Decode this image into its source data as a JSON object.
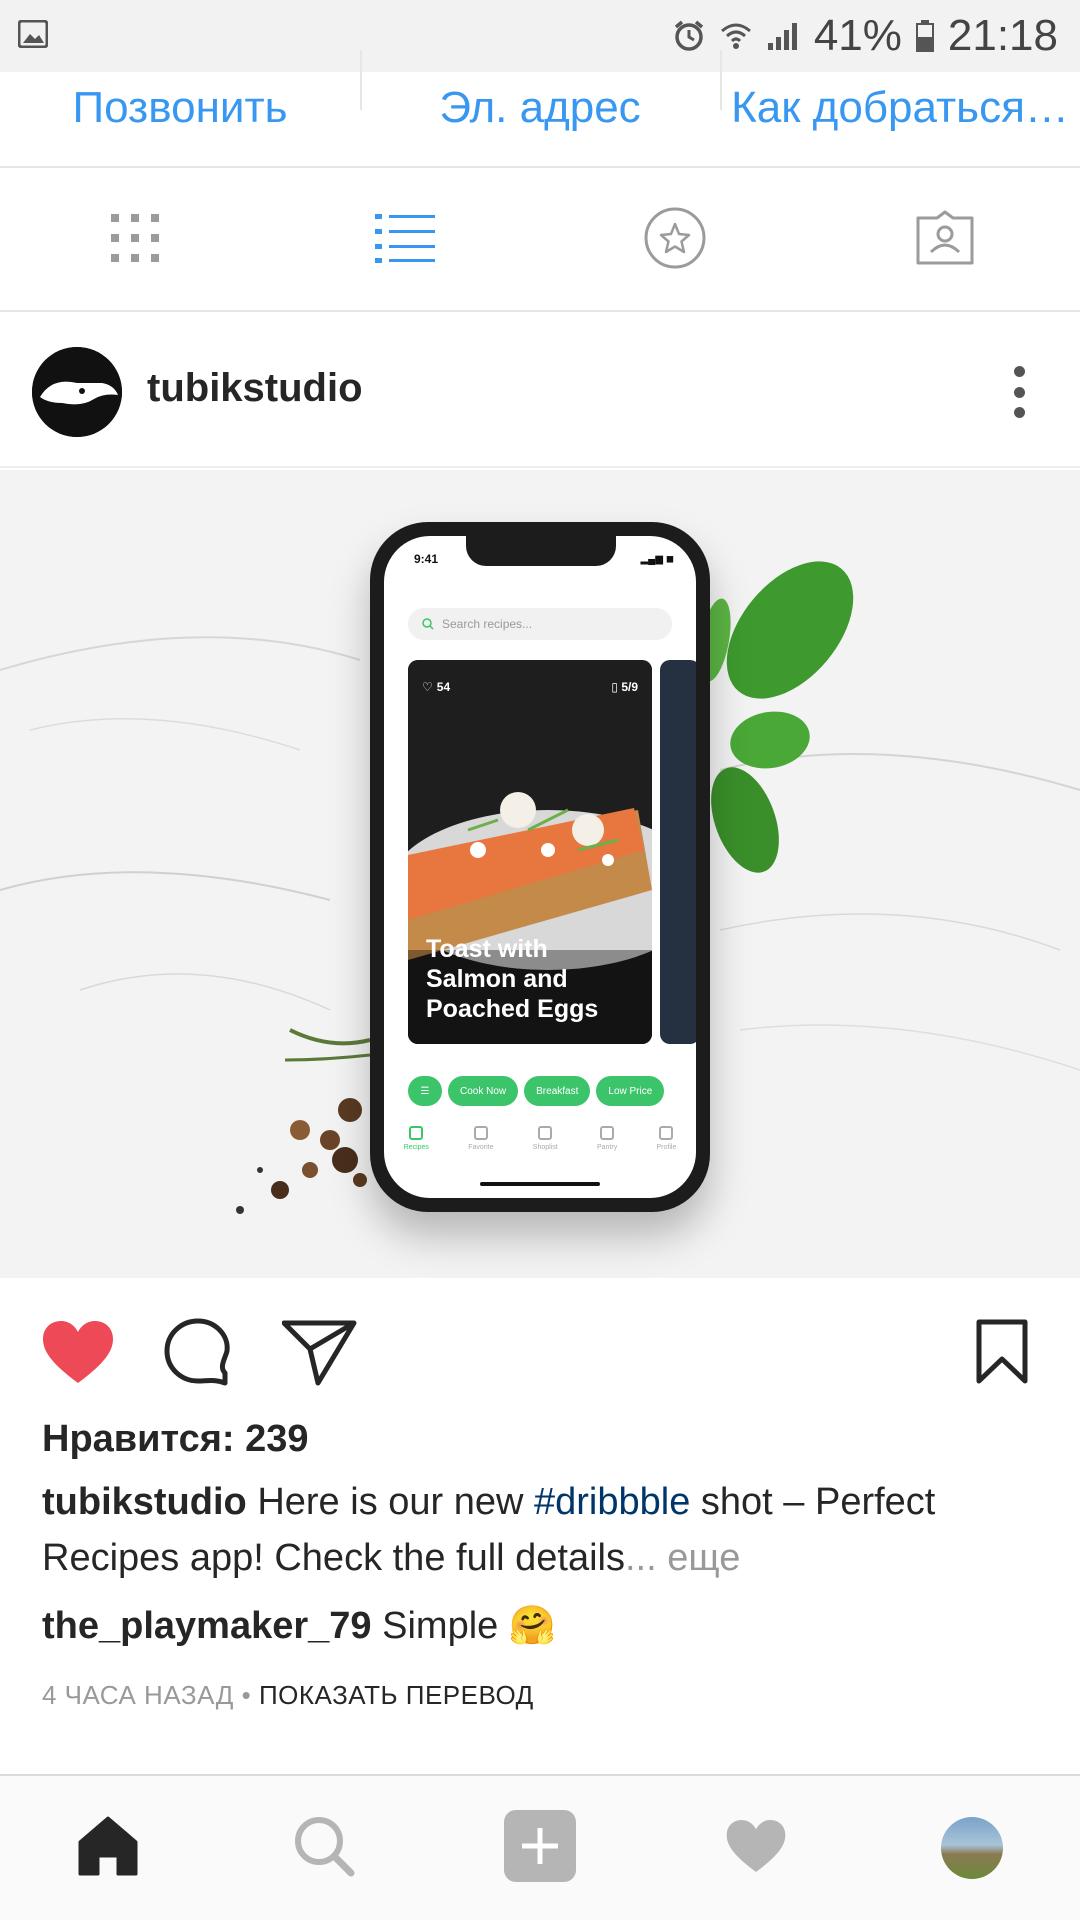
{
  "status_bar": {
    "battery": "41%",
    "time": "21:18",
    "icons": [
      "image-icon",
      "alarm-icon",
      "wifi-icon",
      "signal-icon",
      "battery-icon"
    ]
  },
  "contact_actions": [
    "Позвонить",
    "Эл. адрес",
    "Как добраться"
  ],
  "tabs": [
    "grid-icon",
    "list-icon",
    "star-icon",
    "tagged-icon"
  ],
  "post": {
    "username": "tubikstudio",
    "image": {
      "phone_time": "9:41",
      "search_placeholder": "Search recipes...",
      "card_likes": "54",
      "card_pages": "5/9",
      "card_title": "Toast with Salmon and Poached Eggs",
      "chips": [
        "Cook Now",
        "Breakfast",
        "Low Price"
      ],
      "nav": [
        "Recipes",
        "Favorite",
        "Shoplist",
        "Pantry",
        "Profile"
      ]
    },
    "likes_label": "Нравится: 239",
    "caption_user": "tubikstudio",
    "caption_text_1": " Here is our new ",
    "caption_tag": "#dribbble",
    "caption_text_2": " shot – Perfect Recipes app! Check the full details",
    "caption_more": "... еще",
    "comment_user": "the_playmaker_79",
    "comment_text": " Simple 🤗",
    "time_ago": "4 ЧАСА НАЗАД",
    "separator": " • ",
    "translate": "ПОКАЗАТЬ ПЕРЕВОД"
  },
  "bottom_nav": [
    "home-icon",
    "search-icon",
    "add-icon",
    "activity-icon",
    "profile-avatar"
  ],
  "colors": {
    "link_blue": "#3897f0",
    "tab_active": "#3897f0",
    "like_red": "#ed4956",
    "hashtag": "#003569"
  }
}
